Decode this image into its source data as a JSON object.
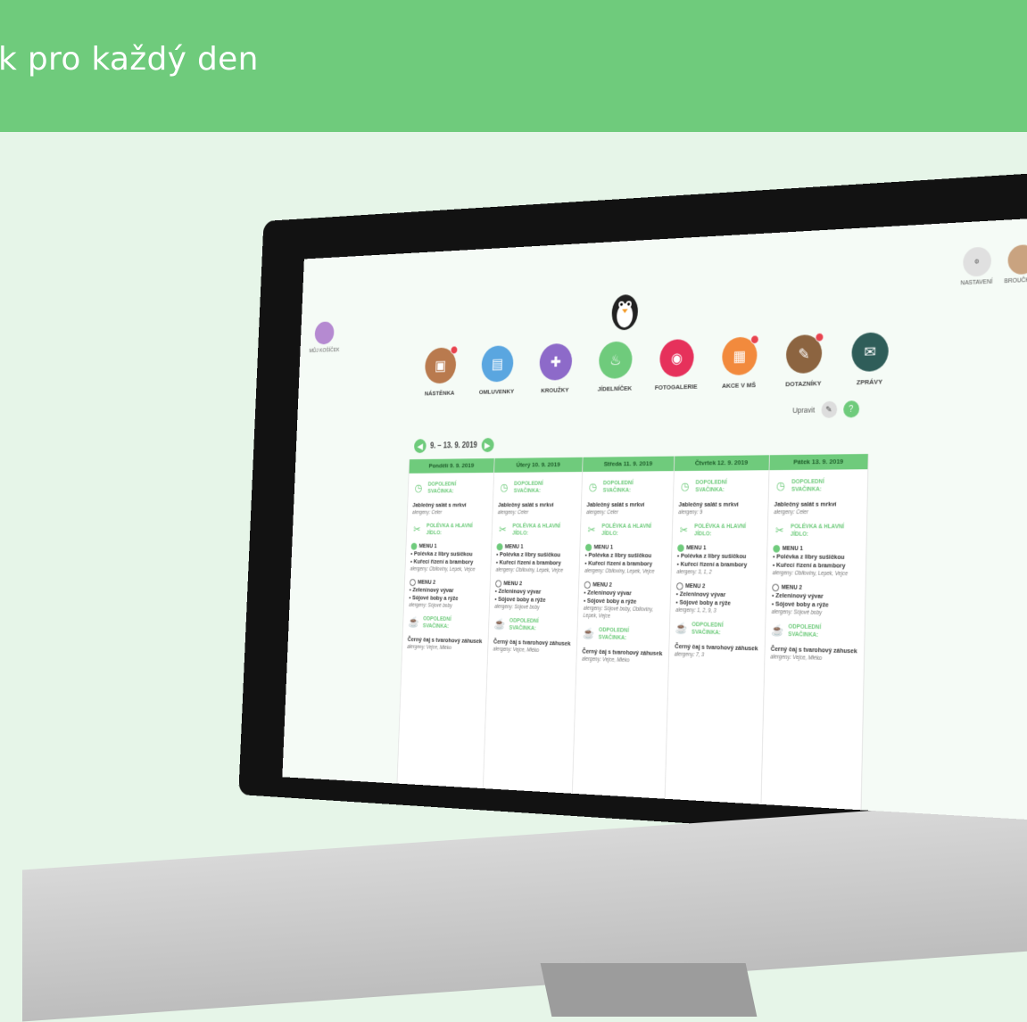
{
  "banner": {
    "title": "k pro každý den"
  },
  "top_left": {
    "label": "MŮJ KOŠÍČEK"
  },
  "top_right": [
    {
      "label": "NASTAVENÍ",
      "icon": "sliders-icon"
    },
    {
      "label": "BROUČKOVI",
      "icon": "avatar"
    }
  ],
  "nav": [
    {
      "label": "NÁSTĚNKA",
      "color": "#b97a4e",
      "icon": "board-icon",
      "badge": true
    },
    {
      "label": "OMLUVENKY",
      "color": "#5aa6e0",
      "icon": "document-icon",
      "badge": false
    },
    {
      "label": "KROUŽKY",
      "color": "#8d6ac9",
      "icon": "puzzle-icon",
      "badge": false
    },
    {
      "label": "JÍDELNÍČEK",
      "color": "#6fcb7c",
      "icon": "food-icon",
      "badge": false
    },
    {
      "label": "FOTOGALERIE",
      "color": "#e6315b",
      "icon": "camera-icon",
      "badge": false
    },
    {
      "label": "AKCE V MŠ",
      "color": "#f28a3d",
      "icon": "calendar-icon",
      "badge": true
    },
    {
      "label": "DOTAZNÍKY",
      "color": "#8c6440",
      "icon": "pencil-icon",
      "badge": true
    },
    {
      "label": "ZPRÁVY",
      "color": "#2f5d59",
      "icon": "mail-icon",
      "badge": false
    }
  ],
  "week": {
    "range": "9. – 13. 9. 2019",
    "edit": "Upravit"
  },
  "days": [
    {
      "head": "Pondělí 9. 9. 2019",
      "snack1": "Jablečný salát s mrkví",
      "snack1_alg": "alergeny: Celer",
      "menu1_title": "MENU 1",
      "menu1_items": [
        "• Polévka z libry sušičkou",
        "• Kuřecí řízení a brambory"
      ],
      "menu1_alg": "alergeny: Obiloviny, Lepek, Vejce",
      "menu2_title": "MENU 2",
      "menu2_items": [
        "• Zeleninový vývar",
        "• Sójové boby a rýže"
      ],
      "menu2_alg": "alergeny: Sójové boby",
      "snack2": "Černý čaj s tvarohový záhusek",
      "snack2_alg": "alergeny: Vejce, Mléko"
    },
    {
      "head": "Úterý 10. 9. 2019",
      "snack1": "Jablečný salát s mrkví",
      "snack1_alg": "alergeny: Celer",
      "menu1_title": "MENU 1",
      "menu1_items": [
        "• Polévka z libry sušičkou",
        "• Kuřecí řízení a brambory"
      ],
      "menu1_alg": "alergeny: Obiloviny, Lepek, Vejce",
      "menu2_title": "MENU 2",
      "menu2_items": [
        "• Zeleninový vývar",
        "• Sójové boby a rýže"
      ],
      "menu2_alg": "alergeny: Sójové boby",
      "snack2": "Černý čaj s tvarohový záhusek",
      "snack2_alg": "alergeny: Vejce, Mléko"
    },
    {
      "head": "Středa 11. 9. 2019",
      "snack1": "Jablečný salát s mrkví",
      "snack1_alg": "alergeny: Celer",
      "menu1_title": "MENU 1",
      "menu1_items": [
        "• Polévka z libry sušičkou",
        "• Kuřecí řízení a brambory"
      ],
      "menu1_alg": "alergeny: Obiloviny, Lepek, Vejce",
      "menu2_title": "MENU 2",
      "menu2_items": [
        "• Zeleninový vývar",
        "• Sójové boby a rýže"
      ],
      "menu2_alg": "alergeny: Sójové boby, Obiloviny, Lepek, Vejce",
      "snack2": "Černý čaj s tvarohový záhusek",
      "snack2_alg": "alergeny: Vejce, Mléko"
    },
    {
      "head": "Čtvrtek 12. 9. 2019",
      "snack1": "Jablečný salát s mrkví",
      "snack1_alg": "alergeny: 9",
      "menu1_title": "MENU 1",
      "menu1_items": [
        "• Polévka z libry sušičkou",
        "• Kuřecí řízení a brambory"
      ],
      "menu1_alg": "alergeny: 3, 1, 2",
      "menu2_title": "MENU 2",
      "menu2_items": [
        "• Zeleninový vývar",
        "• Sójové boby a rýže"
      ],
      "menu2_alg": "alergeny: 1, 2, 9, 3",
      "snack2": "Černý čaj s tvarohový záhusek",
      "snack2_alg": "alergeny: 7, 3"
    },
    {
      "head": "Pátek 13. 9. 2019",
      "snack1": "Jablečný salát s mrkví",
      "snack1_alg": "alergeny: Celer",
      "menu1_title": "MENU 1",
      "menu1_items": [
        "• Polévka z libry sušičkou",
        "• Kuřecí řízení a brambory"
      ],
      "menu1_alg": "alergeny: Obiloviny, Lepek, Vejce",
      "menu2_title": "MENU 2",
      "menu2_items": [
        "• Zeleninový vývar",
        "• Sójové boby a rýže"
      ],
      "menu2_alg": "alergeny: Sójové boby",
      "snack2": "Černý čaj s tvarohový záhusek",
      "snack2_alg": "alergeny: Vejce, Mléko"
    }
  ],
  "labels": {
    "snack_am": "DOPOLEDNÍ SVAČINKA:",
    "lunch": "POLÉVKA & HLAVNÍ JÍDLO:",
    "snack_pm": "ODPOLEDNÍ SVAČINKA:"
  }
}
